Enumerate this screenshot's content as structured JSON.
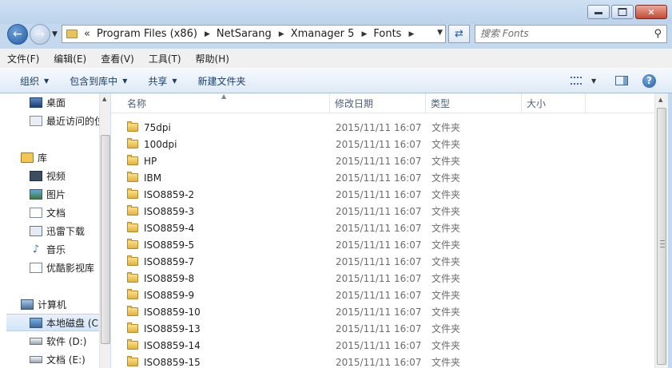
{
  "window": {
    "controls": {
      "minimize": "minimize",
      "maximize": "maximize",
      "close": "×"
    }
  },
  "address": {
    "overflow": "«",
    "crumbs": [
      "Program Files (x86)",
      "NetSarang",
      "Xmanager 5",
      "Fonts"
    ]
  },
  "search": {
    "placeholder": "搜索 Fonts"
  },
  "menu": [
    "文件(F)",
    "编辑(E)",
    "查看(V)",
    "工具(T)",
    "帮助(H)"
  ],
  "toolbar": {
    "organize": "组织",
    "include_library": "包含到库中",
    "share": "共享",
    "new_folder": "新建文件夹"
  },
  "nav": {
    "items": [
      {
        "label": "桌面",
        "icon": "desktop-icon"
      },
      {
        "label": "最近访问的位置",
        "icon": "recent-places-icon"
      },
      {
        "label": "库",
        "icon": "library-icon"
      },
      {
        "label": "视频",
        "icon": "video-icon"
      },
      {
        "label": "图片",
        "icon": "picture-icon"
      },
      {
        "label": "文档",
        "icon": "document-icon"
      },
      {
        "label": "迅雷下载",
        "icon": "thunder-download-icon"
      },
      {
        "label": "音乐",
        "icon": "music-icon"
      },
      {
        "label": "优酷影视库",
        "icon": "youku-icon"
      },
      {
        "label": "计算机",
        "icon": "computer-icon"
      },
      {
        "label": "本地磁盘 (C:)",
        "icon": "system-drive-icon"
      },
      {
        "label": "软件 (D:)",
        "icon": "drive-icon"
      },
      {
        "label": "文档 (E:)",
        "icon": "drive-icon"
      }
    ],
    "selected": "本地磁盘 (C:)"
  },
  "columns": {
    "name": "名称",
    "date": "修改日期",
    "type": "类型",
    "size": "大小"
  },
  "files": [
    {
      "name": "75dpi",
      "date": "2015/11/11 16:07",
      "type": "文件夹"
    },
    {
      "name": "100dpi",
      "date": "2015/11/11 16:07",
      "type": "文件夹"
    },
    {
      "name": "HP",
      "date": "2015/11/11 16:07",
      "type": "文件夹"
    },
    {
      "name": "IBM",
      "date": "2015/11/11 16:07",
      "type": "文件夹"
    },
    {
      "name": "ISO8859-2",
      "date": "2015/11/11 16:07",
      "type": "文件夹"
    },
    {
      "name": "ISO8859-3",
      "date": "2015/11/11 16:07",
      "type": "文件夹"
    },
    {
      "name": "ISO8859-4",
      "date": "2015/11/11 16:07",
      "type": "文件夹"
    },
    {
      "name": "ISO8859-5",
      "date": "2015/11/11 16:07",
      "type": "文件夹"
    },
    {
      "name": "ISO8859-7",
      "date": "2015/11/11 16:07",
      "type": "文件夹"
    },
    {
      "name": "ISO8859-8",
      "date": "2015/11/11 16:07",
      "type": "文件夹"
    },
    {
      "name": "ISO8859-9",
      "date": "2015/11/11 16:07",
      "type": "文件夹"
    },
    {
      "name": "ISO8859-10",
      "date": "2015/11/11 16:07",
      "type": "文件夹"
    },
    {
      "name": "ISO8859-13",
      "date": "2015/11/11 16:07",
      "type": "文件夹"
    },
    {
      "name": "ISO8859-14",
      "date": "2015/11/11 16:07",
      "type": "文件夹"
    },
    {
      "name": "ISO8859-15",
      "date": "2015/11/11 16:07",
      "type": "文件夹"
    }
  ]
}
